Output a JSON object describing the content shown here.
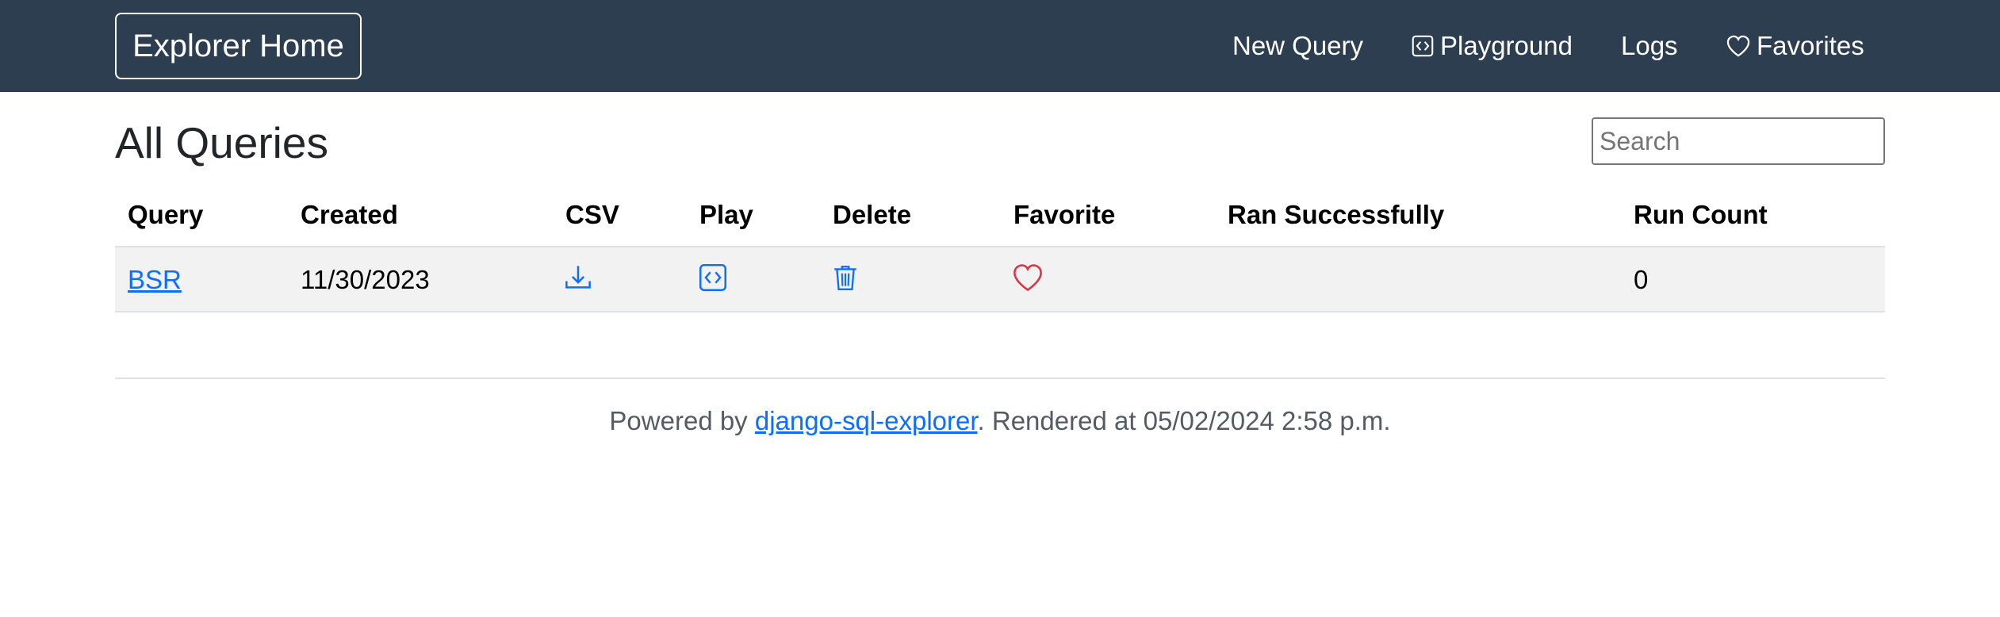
{
  "navbar": {
    "brand": "Explorer Home",
    "links": [
      {
        "label": "New Query"
      },
      {
        "label": "Playground",
        "icon": "code-square-icon"
      },
      {
        "label": "Logs"
      },
      {
        "label": "Favorites",
        "icon": "heart-icon"
      }
    ]
  },
  "page": {
    "title": "All Queries",
    "search_placeholder": "Search"
  },
  "table": {
    "columns": [
      "Query",
      "Created",
      "CSV",
      "Play",
      "Delete",
      "Favorite",
      "Ran Successfully",
      "Run Count"
    ],
    "rows": [
      {
        "query": "BSR",
        "created": "11/30/2023",
        "csv_icon": "download-icon",
        "play_icon": "code-square-icon",
        "delete_icon": "trash-icon",
        "favorite_icon": "heart-icon",
        "ran_successfully": "",
        "run_count": "0"
      }
    ]
  },
  "footer": {
    "prefix": "Powered by ",
    "link": "django-sql-explorer",
    "suffix": ". Rendered at 05/02/2024 2:58 p.m."
  },
  "colors": {
    "navbar": "#2c3e50",
    "link": "#0d6efd",
    "heart": "#dc3545",
    "row_bg": "#f2f2f2"
  }
}
